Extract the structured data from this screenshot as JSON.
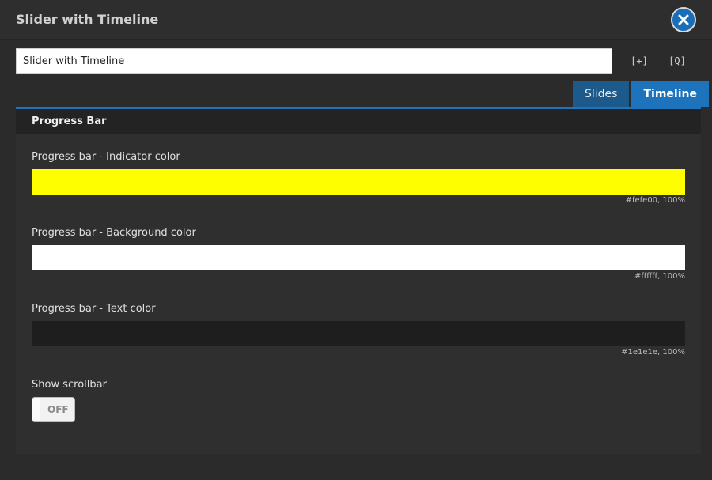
{
  "window": {
    "title": "Slider with Timeline"
  },
  "toolbar": {
    "name_value": "Slider with Timeline",
    "shortcode_icon_text": "[+]",
    "preview_icon_text": "[Q]"
  },
  "tabs": [
    {
      "label": "Slides",
      "active": false
    },
    {
      "label": "Timeline",
      "active": true
    }
  ],
  "panel": {
    "title": "Progress Bar",
    "fields": [
      {
        "label": "Progress bar - Indicator color",
        "color": "#fefe00",
        "info": "#fefe00, 100%"
      },
      {
        "label": "Progress bar - Background color",
        "color": "#ffffff",
        "info": "#ffffff, 100%"
      },
      {
        "label": "Progress bar - Text color",
        "color": "#1e1e1e",
        "info": "#1e1e1e, 100%"
      }
    ],
    "scrollbar": {
      "label": "Show scrollbar",
      "state": "OFF"
    }
  },
  "colors": {
    "accent": "#1d74bd",
    "tab_inactive": "#1c5a8c",
    "panel_bg": "#2f2f2f"
  },
  "icons": {
    "close": "close-icon",
    "shortcode": "add-bracket-icon",
    "preview": "preview-bracket-icon"
  }
}
